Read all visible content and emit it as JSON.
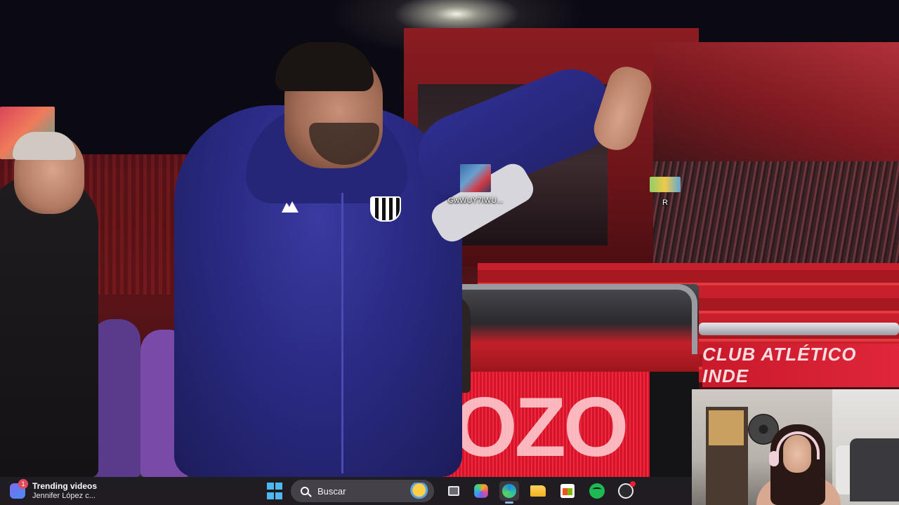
{
  "wallpaper": {
    "board_text": "CLUB ATLÉTICO INDE",
    "led_text": "IOZO"
  },
  "desktop_icons": [
    {
      "label": "GwWUY7IWU...",
      "icon": "video-thumbnail-icon"
    },
    {
      "label": "R",
      "icon": "image-thumbnail-icon"
    }
  ],
  "taskbar": {
    "widget": {
      "badge": "1",
      "title": "Trending videos",
      "subtitle": "Jennifer López c..."
    },
    "search": {
      "label": "Buscar"
    },
    "apps": [
      {
        "name": "start",
        "icon": "windows-start-icon"
      },
      {
        "name": "task-view",
        "icon": "task-view-icon"
      },
      {
        "name": "copilot",
        "icon": "copilot-icon"
      },
      {
        "name": "edge",
        "icon": "edge-browser-icon",
        "active": true
      },
      {
        "name": "file-explorer",
        "icon": "folder-icon"
      },
      {
        "name": "microsoft-store",
        "icon": "store-icon"
      },
      {
        "name": "spotify",
        "icon": "spotify-icon"
      },
      {
        "name": "obs",
        "icon": "obs-icon"
      }
    ]
  },
  "colors": {
    "taskbar_bg": "#201e24",
    "accent": "#4cb8f0",
    "club_red": "#d3142a",
    "jacket_blue": "#2a2a84"
  }
}
